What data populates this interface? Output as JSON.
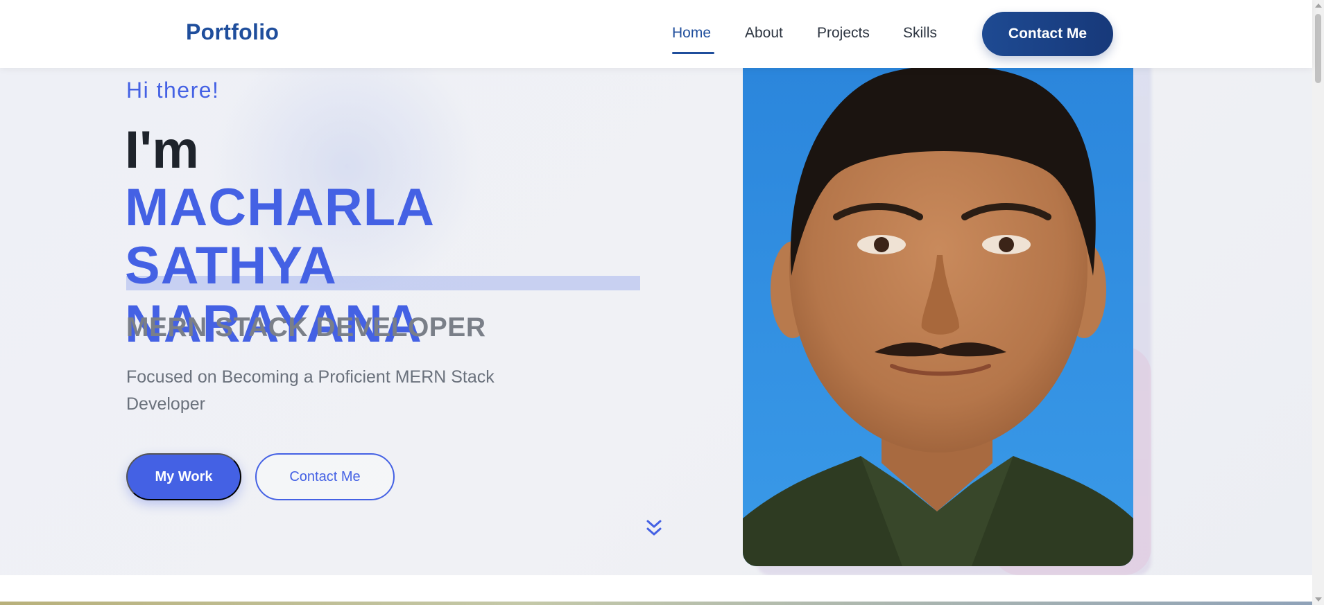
{
  "nav": {
    "brand": "Portfolio",
    "links": [
      {
        "label": "Home",
        "active": true
      },
      {
        "label": "About",
        "active": false
      },
      {
        "label": "Projects",
        "active": false
      },
      {
        "label": "Skills",
        "active": false
      }
    ],
    "cta_label": "Contact Me"
  },
  "hero": {
    "greeting": "Hi there!",
    "intro": "I'm",
    "name_line1": "MACHARLA SATHYA",
    "name_line2": "NARAYANA",
    "role": "MERN STACK DEVELOPER",
    "tagline": "Focused on Becoming a Proficient MERN Stack Developer",
    "primary_button": "My Work",
    "secondary_button": "Contact Me",
    "scroll_icon": "double-chevron-down-icon",
    "photo_alt": "Profile photo"
  },
  "colors": {
    "brand": "#1f4e9c",
    "accent": "#4461e4",
    "heading": "#1e232b",
    "role": "#7a7f88",
    "body_text": "#6a717c",
    "photo_background": "#2f8fe0"
  }
}
